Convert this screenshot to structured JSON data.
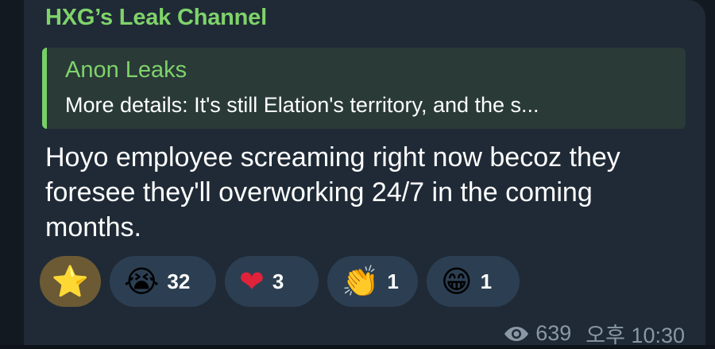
{
  "channel": {
    "name": "HXG’s Leak Channel"
  },
  "reply": {
    "author": "Anon Leaks",
    "text": "More details: It's still Elation's territory, and the s..."
  },
  "message": {
    "text": "Hoyo employee screaming right now becoz they foresee they'll overworking 24/7 in the coming months."
  },
  "reactions": [
    {
      "icon": "star-icon",
      "emoji": "⭐",
      "count": ""
    },
    {
      "icon": "crying-face-icon",
      "emoji": "😭",
      "count": "32"
    },
    {
      "icon": "heart-icon",
      "emoji": "❤",
      "count": "3"
    },
    {
      "icon": "clapping-hands-icon",
      "emoji": "👏",
      "count": "1"
    },
    {
      "icon": "grinning-face-icon",
      "emoji": "😁",
      "count": "1"
    }
  ],
  "meta": {
    "views": "639",
    "time": "오후 10:30"
  },
  "colors": {
    "accent": "#7fd36a",
    "bubble": "#1f2a36",
    "reaction_bg": "#2c3f52"
  }
}
